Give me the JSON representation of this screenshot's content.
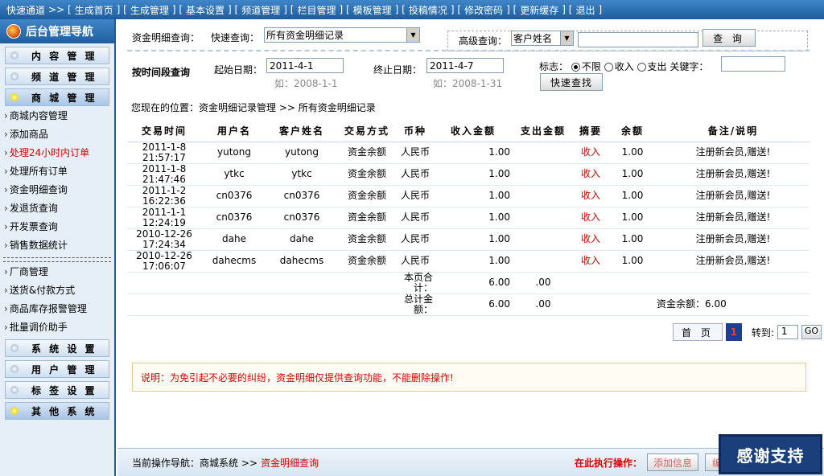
{
  "topnav": {
    "items": [
      "快速通道",
      "生成首页",
      "生成管理",
      "基本设置",
      "频道管理",
      "栏目管理",
      "模板管理",
      "投稿情况",
      "修改密码",
      "更新缓存",
      "退出"
    ]
  },
  "sidebar": {
    "title": "后台管理导航",
    "sections": [
      {
        "label": "内 容 管 理"
      },
      {
        "label": "频 道 管 理"
      },
      {
        "label": "商 城 管 理"
      }
    ],
    "items_a": [
      "商城内容管理",
      "添加商品",
      "处理24小时内订单",
      "处理所有订单",
      "资金明细查询",
      "发退货查询",
      "开发票查询",
      "销售数据统计"
    ],
    "items_b": [
      "厂商管理",
      "送货&付款方式",
      "商品库存报警管理",
      "批量调价助手"
    ],
    "sections_b": [
      {
        "label": "系 统 设 置"
      },
      {
        "label": "用 户 管 理"
      },
      {
        "label": "标 签 设 置"
      },
      {
        "label": "其 他 系 统"
      }
    ]
  },
  "search": {
    "title": "资金明细查询：",
    "quick_label": "快速查询：",
    "quick_value": "所有资金明细记录",
    "adv_label": "高级查询：",
    "adv_field": "客户姓名",
    "query_btn": "查 询"
  },
  "date": {
    "title": "按时间段查询",
    "start_label": "起始日期：",
    "start_value": "2011-4-1",
    "start_hint": "如：2008-1-1",
    "end_label": "终止日期：",
    "end_value": "2011-4-7",
    "end_hint": "如：2008-1-31",
    "flag_label": "标志：",
    "opt_all": "不限",
    "opt_in": "收入",
    "opt_out": "支出",
    "keyword_label": "关键字：",
    "fast_btn": "快速查找"
  },
  "breadcrumb": "您现在的位置：资金明细记录管理 >> 所有资金明细记录",
  "table": {
    "headers": [
      "交易时间",
      "用户名",
      "客户姓名",
      "交易方式",
      "币种",
      "收入金额",
      "支出金额",
      "摘要",
      "余额",
      "备注/说明"
    ],
    "rows": [
      {
        "time": "2011-1-8 21:57:17",
        "user": "yutong",
        "name": "yutong",
        "method": "资金余额",
        "currency": "人民币",
        "income": "1.00",
        "out": "",
        "summary": "收入",
        "balance": "1.00",
        "note": "注册新会员,赠送!"
      },
      {
        "time": "2011-1-8 21:47:46",
        "user": "ytkc",
        "name": "ytkc",
        "method": "资金余额",
        "currency": "人民币",
        "income": "1.00",
        "out": "",
        "summary": "收入",
        "balance": "1.00",
        "note": "注册新会员,赠送!"
      },
      {
        "time": "2011-1-2 16:22:36",
        "user": "cn0376",
        "name": "cn0376",
        "method": "资金余额",
        "currency": "人民币",
        "income": "1.00",
        "out": "",
        "summary": "收入",
        "balance": "1.00",
        "note": "注册新会员,赠送!"
      },
      {
        "time": "2011-1-1 12:24:19",
        "user": "cn0376",
        "name": "cn0376",
        "method": "资金余额",
        "currency": "人民币",
        "income": "1.00",
        "out": "",
        "summary": "收入",
        "balance": "1.00",
        "note": "注册新会员,赠送!"
      },
      {
        "time": "2010-12-26 17:24:34",
        "user": "dahe",
        "name": "dahe",
        "method": "资金余额",
        "currency": "人民币",
        "income": "1.00",
        "out": "",
        "summary": "收入",
        "balance": "1.00",
        "note": "注册新会员,赠送!"
      },
      {
        "time": "2010-12-26 17:06:07",
        "user": "dahecms",
        "name": "dahecms",
        "method": "资金余额",
        "currency": "人民币",
        "income": "1.00",
        "out": "",
        "summary": "收入",
        "balance": "1.00",
        "note": "注册新会员,赠送!"
      }
    ],
    "page_total_label": "本页合计：",
    "page_total_in": "6.00",
    "page_total_out": ".00",
    "grand_total_label": "总计金额：",
    "grand_total_in": "6.00",
    "grand_total_out": ".00",
    "balance_text": "资金余额：6.00"
  },
  "pager": {
    "first": "首 页",
    "current": "1",
    "goto_label": "转到:",
    "goto_value": "1",
    "go_btn": "GO"
  },
  "notice": "说明：为免引起不必要的纠纷，资金明细仅提供查询功能，不能删除操作!",
  "footer": {
    "nav_label": "当前操作导航：商城系统 >>",
    "nav_current": "资金明细查询",
    "exec_label": "在此执行操作：",
    "add_btn": "添加信息",
    "edit_btn": "编"
  },
  "overlay": "感谢支持"
}
